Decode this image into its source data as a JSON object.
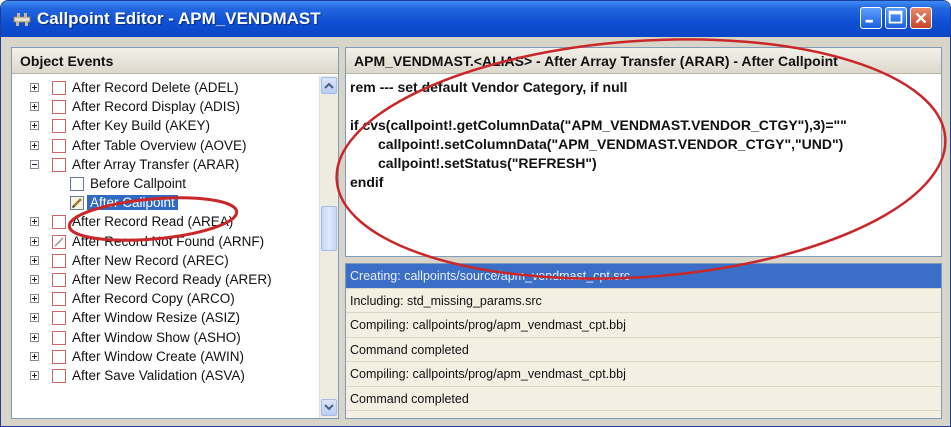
{
  "window": {
    "title": "Callpoint Editor - APM_VENDMAST",
    "colors": {
      "titlebar": "#0f4fd3",
      "selection": "#316ac5",
      "annotation": "#c9272a"
    }
  },
  "left_panel": {
    "header": "Object Events",
    "items": [
      {
        "label": "After Record Delete (ADEL)",
        "expander": "plus",
        "checked": false
      },
      {
        "label": "After Record Display (ADIS)",
        "expander": "plus",
        "checked": false
      },
      {
        "label": "After Key Build (AKEY)",
        "expander": "plus",
        "checked": false
      },
      {
        "label": "After Table Overview (AOVE)",
        "expander": "plus",
        "checked": false
      },
      {
        "label": "After Array Transfer (ARAR)",
        "expander": "minus",
        "checked": false
      },
      {
        "label": "Before Callpoint",
        "child": true,
        "icon": "empty-doc-icon"
      },
      {
        "label": "After Callpoint",
        "child": true,
        "icon": "edit-doc-icon",
        "selected": true
      },
      {
        "label": "After Record Read (AREA)",
        "expander": "plus",
        "checked": false
      },
      {
        "label": "After Record Not Found (ARNF)",
        "expander": "plus",
        "checked": true
      },
      {
        "label": "After New Record (AREC)",
        "expander": "plus",
        "checked": false
      },
      {
        "label": "After New Record Ready (ARER)",
        "expander": "plus",
        "checked": false
      },
      {
        "label": "After Record Copy (ARCO)",
        "expander": "plus",
        "checked": false
      },
      {
        "label": "After Window Resize (ASIZ)",
        "expander": "plus",
        "checked": false
      },
      {
        "label": "After Window Show (ASHO)",
        "expander": "plus",
        "checked": false
      },
      {
        "label": "After Window Create (AWIN)",
        "expander": "plus",
        "checked": false
      },
      {
        "label": "After Save Validation (ASVA)",
        "expander": "plus",
        "checked": false
      }
    ]
  },
  "code_panel": {
    "header": "APM_VENDMAST.<ALIAS> - After Array Transfer (ARAR) - After Callpoint",
    "lines": [
      {
        "text": "rem --- set default Vendor Category, if null",
        "indent": false
      },
      {
        "text": "",
        "indent": false
      },
      {
        "text": "if cvs(callpoint!.getColumnData(\"APM_VENDMAST.VENDOR_CTGY\"),3)=\"\"",
        "indent": false
      },
      {
        "text": "callpoint!.setColumnData(\"APM_VENDMAST.VENDOR_CTGY\",\"UND\")",
        "indent": true
      },
      {
        "text": "callpoint!.setStatus(\"REFRESH\")",
        "indent": true
      },
      {
        "text": "endif",
        "indent": false
      }
    ]
  },
  "log_panel": {
    "rows": [
      {
        "text": "Creating: callpoints/source/apm_vendmast_cpt.src",
        "selected": true
      },
      {
        "text": "Including: std_missing_params.src",
        "selected": false
      },
      {
        "text": "Compiling: callpoints/prog/apm_vendmast_cpt.bbj",
        "selected": false
      },
      {
        "text": "Command completed",
        "selected": false
      },
      {
        "text": "Compiling: callpoints/prog/apm_vendmast_cpt.bbj",
        "selected": false
      },
      {
        "text": "Command completed",
        "selected": false
      }
    ]
  }
}
